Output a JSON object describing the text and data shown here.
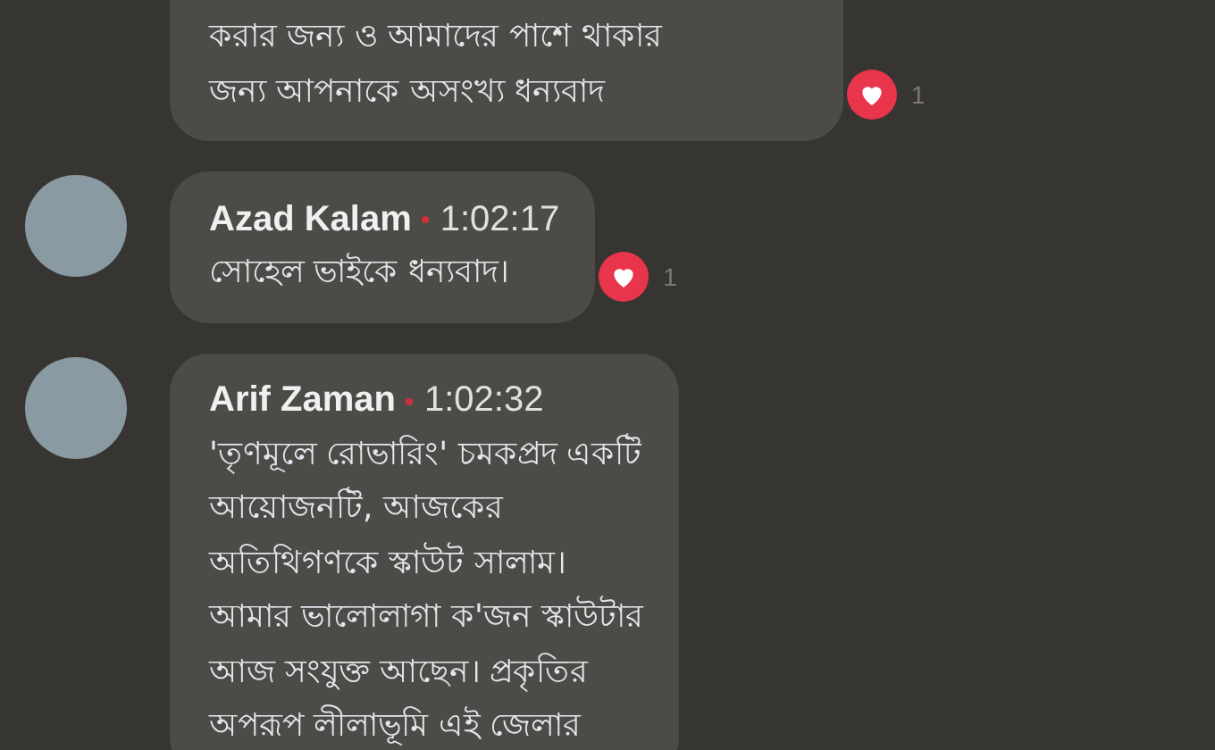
{
  "comments": [
    {
      "lines": [
        "করার  জন্য ও আমাদের পাশে থাকার",
        "জন্য  আপনাকে অসংখ্য ধন্যবাদ"
      ],
      "reaction_count": "1"
    },
    {
      "author": "Azad Kalam",
      "time": "1:02:17",
      "lines": [
        "সোহেল ভাইকে ধন্যবাদ।"
      ],
      "reaction_count": "1"
    },
    {
      "author": "Arif Zaman",
      "time": "1:02:32",
      "lines": [
        "'তৃণমূলে রোভারিং' চমকপ্রদ একটি",
        "আয়োজনটি, আজকের",
        "অতিথিগণকে স্কাউট সালাম।",
        "আমার ভালোলাগা ক'জন স্কাউটার",
        "আজ সংযুক্ত আছেন।  প্রকৃতির",
        "অপরূপ লীলাভূমি এই জেলার"
      ]
    }
  ]
}
